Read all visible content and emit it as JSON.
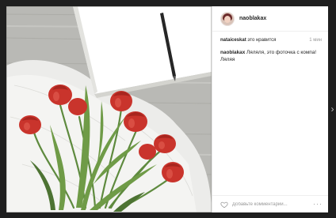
{
  "post": {
    "username": "naoblakax",
    "activity": {
      "user": "nataiceskat",
      "text": " это нравится",
      "time": "1 мин"
    },
    "caption": {
      "user": "naoblakax",
      "text": " Ляляля, это фоточка с компа! Ляляя"
    },
    "comment_placeholder": "Добавьте комментарий...",
    "more_label": "···"
  },
  "nav": {
    "next_label": "›"
  },
  "icons": {
    "heart": "heart-icon",
    "more": "more-options-icon",
    "next": "chevron-right-icon"
  },
  "colors": {
    "overlay": "#1f1f1f",
    "tulip": "#c9342c",
    "leaf": "#5e8a3e"
  }
}
